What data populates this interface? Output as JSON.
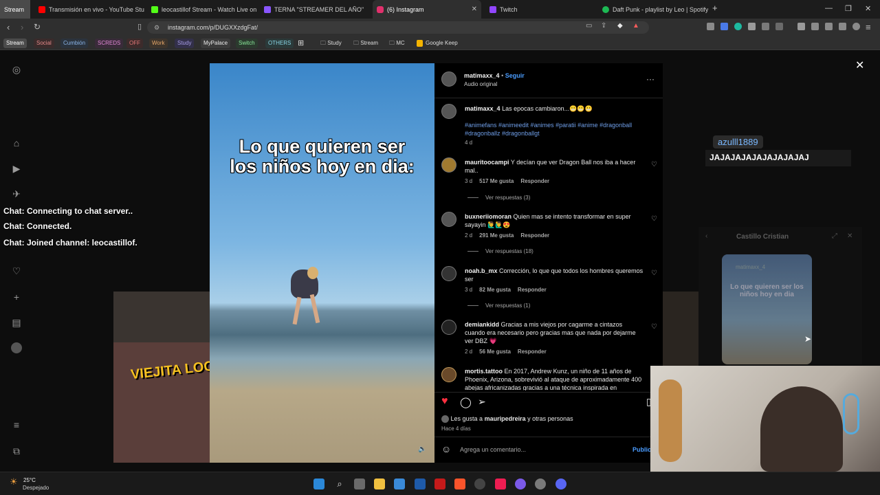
{
  "browser": {
    "tabs": [
      {
        "label": "Stream",
        "color": "#4a4a4a"
      },
      {
        "label": "Transmisión en vivo - YouTube Studio",
        "color": "#ff0000"
      },
      {
        "label": "leocastillof Stream - Watch Live on K",
        "color": "#53fc18"
      },
      {
        "label": "TERNA \"STREAMER DEL AÑO\"",
        "color": "#8a56ff"
      },
      {
        "label": "(6) Instagram",
        "color": "#e1306c"
      },
      {
        "label": "Twitch",
        "color": "#9146ff"
      },
      {
        "label": "Daft Punk - playlist by Leo | Spotify",
        "color": "#1db954"
      }
    ],
    "url": "instagram.com/p/DUGXXzdgFat/",
    "bookmarks": [
      {
        "label": "Stream",
        "bg": "#4b4b4b",
        "fg": "#ffffff"
      },
      {
        "label": "Social",
        "bg": "#3a2b2b",
        "fg": "#e58a8a"
      },
      {
        "label": "Cumbión",
        "bg": "#2b333d",
        "fg": "#8ab4e8"
      },
      {
        "label": "SCREDS",
        "bg": "#3a2b3a",
        "fg": "#e38ad8"
      },
      {
        "label": "OFF",
        "bg": "#3d2b2b",
        "fg": "#e87a7a"
      },
      {
        "label": "Work",
        "bg": "#3d342b",
        "fg": "#e8a86a"
      },
      {
        "label": "Study",
        "bg": "#33304a",
        "fg": "#a89ee8"
      },
      {
        "label": "MyPalace",
        "bg": "#3b3b3b",
        "fg": "#eaeaea"
      },
      {
        "label": "Switch",
        "bg": "#2b3a2e",
        "fg": "#8ae89a"
      },
      {
        "label": "OTHERS",
        "bg": "#2b3a3a",
        "fg": "#8ad8e8"
      }
    ],
    "bookmark_folders": [
      "Study",
      "Stream",
      "MC",
      "Google Keep"
    ]
  },
  "post": {
    "author": "matimaxx_4",
    "follow": "Seguir",
    "audio": "Audio original",
    "reel_caption_line1": "Lo que quieren ser",
    "reel_caption_line2": "los niños hoy en dia:",
    "caption": {
      "user": "matimaxx_4",
      "text": "Las epocas cambiaron...😬😬😬",
      "hashtags": "#animefans #animeedit #animes #paratii #anime #dragonball #dragonballz #dragonballgt",
      "time": "4 d"
    },
    "comments": [
      {
        "user": "mauritoocampi",
        "text": "Y decían que ver Dragon Ball nos iba a hacer mal..",
        "time": "3 d",
        "likes": "517 Me gusta",
        "reply": "Responder",
        "replies": "Ver respuestas (3)"
      },
      {
        "user": "buxneriiomoran",
        "text": "Quien mas se intento transformar en super sayayin 🙋‍♂️🙋‍♂️😍",
        "time": "2 d",
        "likes": "291 Me gusta",
        "reply": "Responder",
        "replies": "Ver respuestas (18)"
      },
      {
        "user": "noah.b_mx",
        "text": "Corrección, lo que que todos los hombres queremos ser",
        "time": "3 d",
        "likes": "82 Me gusta",
        "reply": "Responder",
        "replies": "Ver respuestas (1)"
      },
      {
        "user": "demiankidd",
        "text": "Gracias a mis viejos por cagarme a cintazos cuando era necesario pero gracias mas que nada por dejarme ver DBZ 💗",
        "time": "2 d",
        "likes": "56 Me gusta",
        "reply": "Responder",
        "replies": ""
      },
      {
        "user": "mortis.tattoo",
        "text": "En 2017, Andrew Kunz, un niño de 11 años de Phoenix, Arizona, sobrevivió al ataque de aproximadamente 400 abejas africanizadas gracias a una técnica inspirada en",
        "time": "",
        "likes": "",
        "reply": "",
        "replies": ""
      }
    ],
    "likes_prefix": "Les gusta a",
    "likes_user": "mauripedreira",
    "likes_suffix": "y otras personas",
    "posted": "Hace 4 días",
    "comment_placeholder": "Agrega un comentario...",
    "publish": "Publicar"
  },
  "overlays": {
    "chat_lines": [
      "Chat: Connecting to chat server..",
      "Chat: Connected.",
      "Chat: Joined channel: leocastillof."
    ],
    "chat_user": "azulll1889",
    "chat_message": "JAJAJAJAJAJAJAJAJAJ",
    "popup_title": "Castillo Cristian",
    "sticker_text": "VIEJITA LOC",
    "mini_user": "matimaxx_4",
    "mini_caption": "Lo que quieren ser los niños hoy en dia"
  },
  "taskbar": {
    "temp": "25°C",
    "weather": "Despejado"
  },
  "colors": {
    "like_red": "#ff3040",
    "link_blue": "#4a9cff",
    "hashtag_blue": "#6f9ee8"
  }
}
